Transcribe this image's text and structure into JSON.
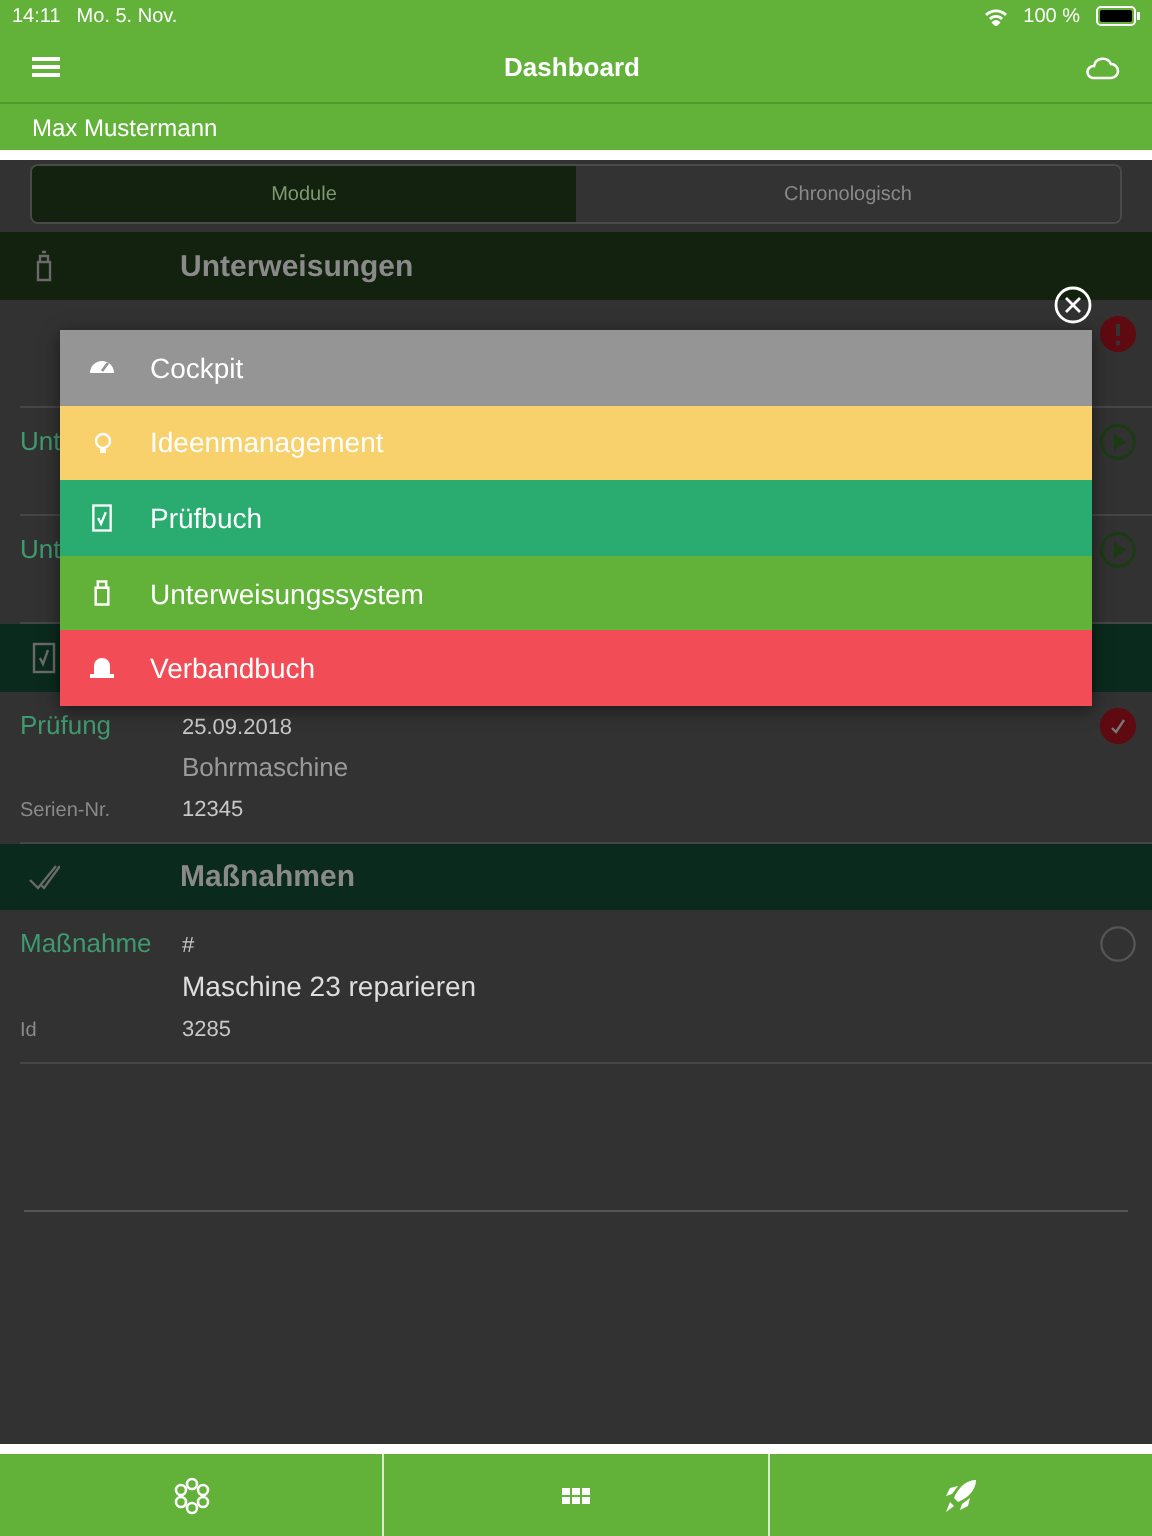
{
  "status_bar": {
    "time": "14:11",
    "date": "Mo. 5. Nov.",
    "battery": "100 %"
  },
  "nav": {
    "title": "Dashboard",
    "user": "Max Mustermann"
  },
  "segments": [
    {
      "label": "Module",
      "selected": true
    },
    {
      "label": "Chronologisch",
      "selected": false
    }
  ],
  "sections": [
    {
      "kind": "training",
      "title": "Unterweisungen",
      "rows": [
        {
          "kind": "alert"
        },
        {
          "kind": "play",
          "lines": [
            {
              "kind": "head",
              "label": "Unt"
            }
          ]
        },
        {
          "kind": "play",
          "lines": [
            {
              "kind": "head",
              "label": "Unt"
            }
          ]
        }
      ]
    },
    {
      "kind": "inspection",
      "rows": [
        {
          "kind": "done",
          "lines": [
            {
              "kind": "head",
              "label": "Prüfung",
              "value": "25.09.2018"
            },
            {
              "kind": "muted-name",
              "value": "Bohrmaschine"
            },
            {
              "kind": "detail",
              "label": "Serien-Nr.",
              "value": "12345"
            }
          ]
        }
      ]
    },
    {
      "kind": "measures",
      "title": "Maßnahmen",
      "rows": [
        {
          "kind": "open",
          "lines": [
            {
              "kind": "head",
              "label": "Maßnahme",
              "value": "#"
            },
            {
              "kind": "name",
              "value": "Maschine 23 reparieren"
            },
            {
              "kind": "detail",
              "label": "Id",
              "value": "3285"
            }
          ]
        }
      ]
    }
  ],
  "menu": {
    "items": [
      {
        "label": "Cockpit",
        "color": "#959595"
      },
      {
        "label": "Ideenmanagement",
        "color": "#f8d06c"
      },
      {
        "label": "Prüfbuch",
        "color": "#2aab70"
      },
      {
        "label": "Unterweisungssystem",
        "color": "#62b23a"
      },
      {
        "label": "Verbandbuch",
        "color": "#f24d57"
      }
    ]
  }
}
